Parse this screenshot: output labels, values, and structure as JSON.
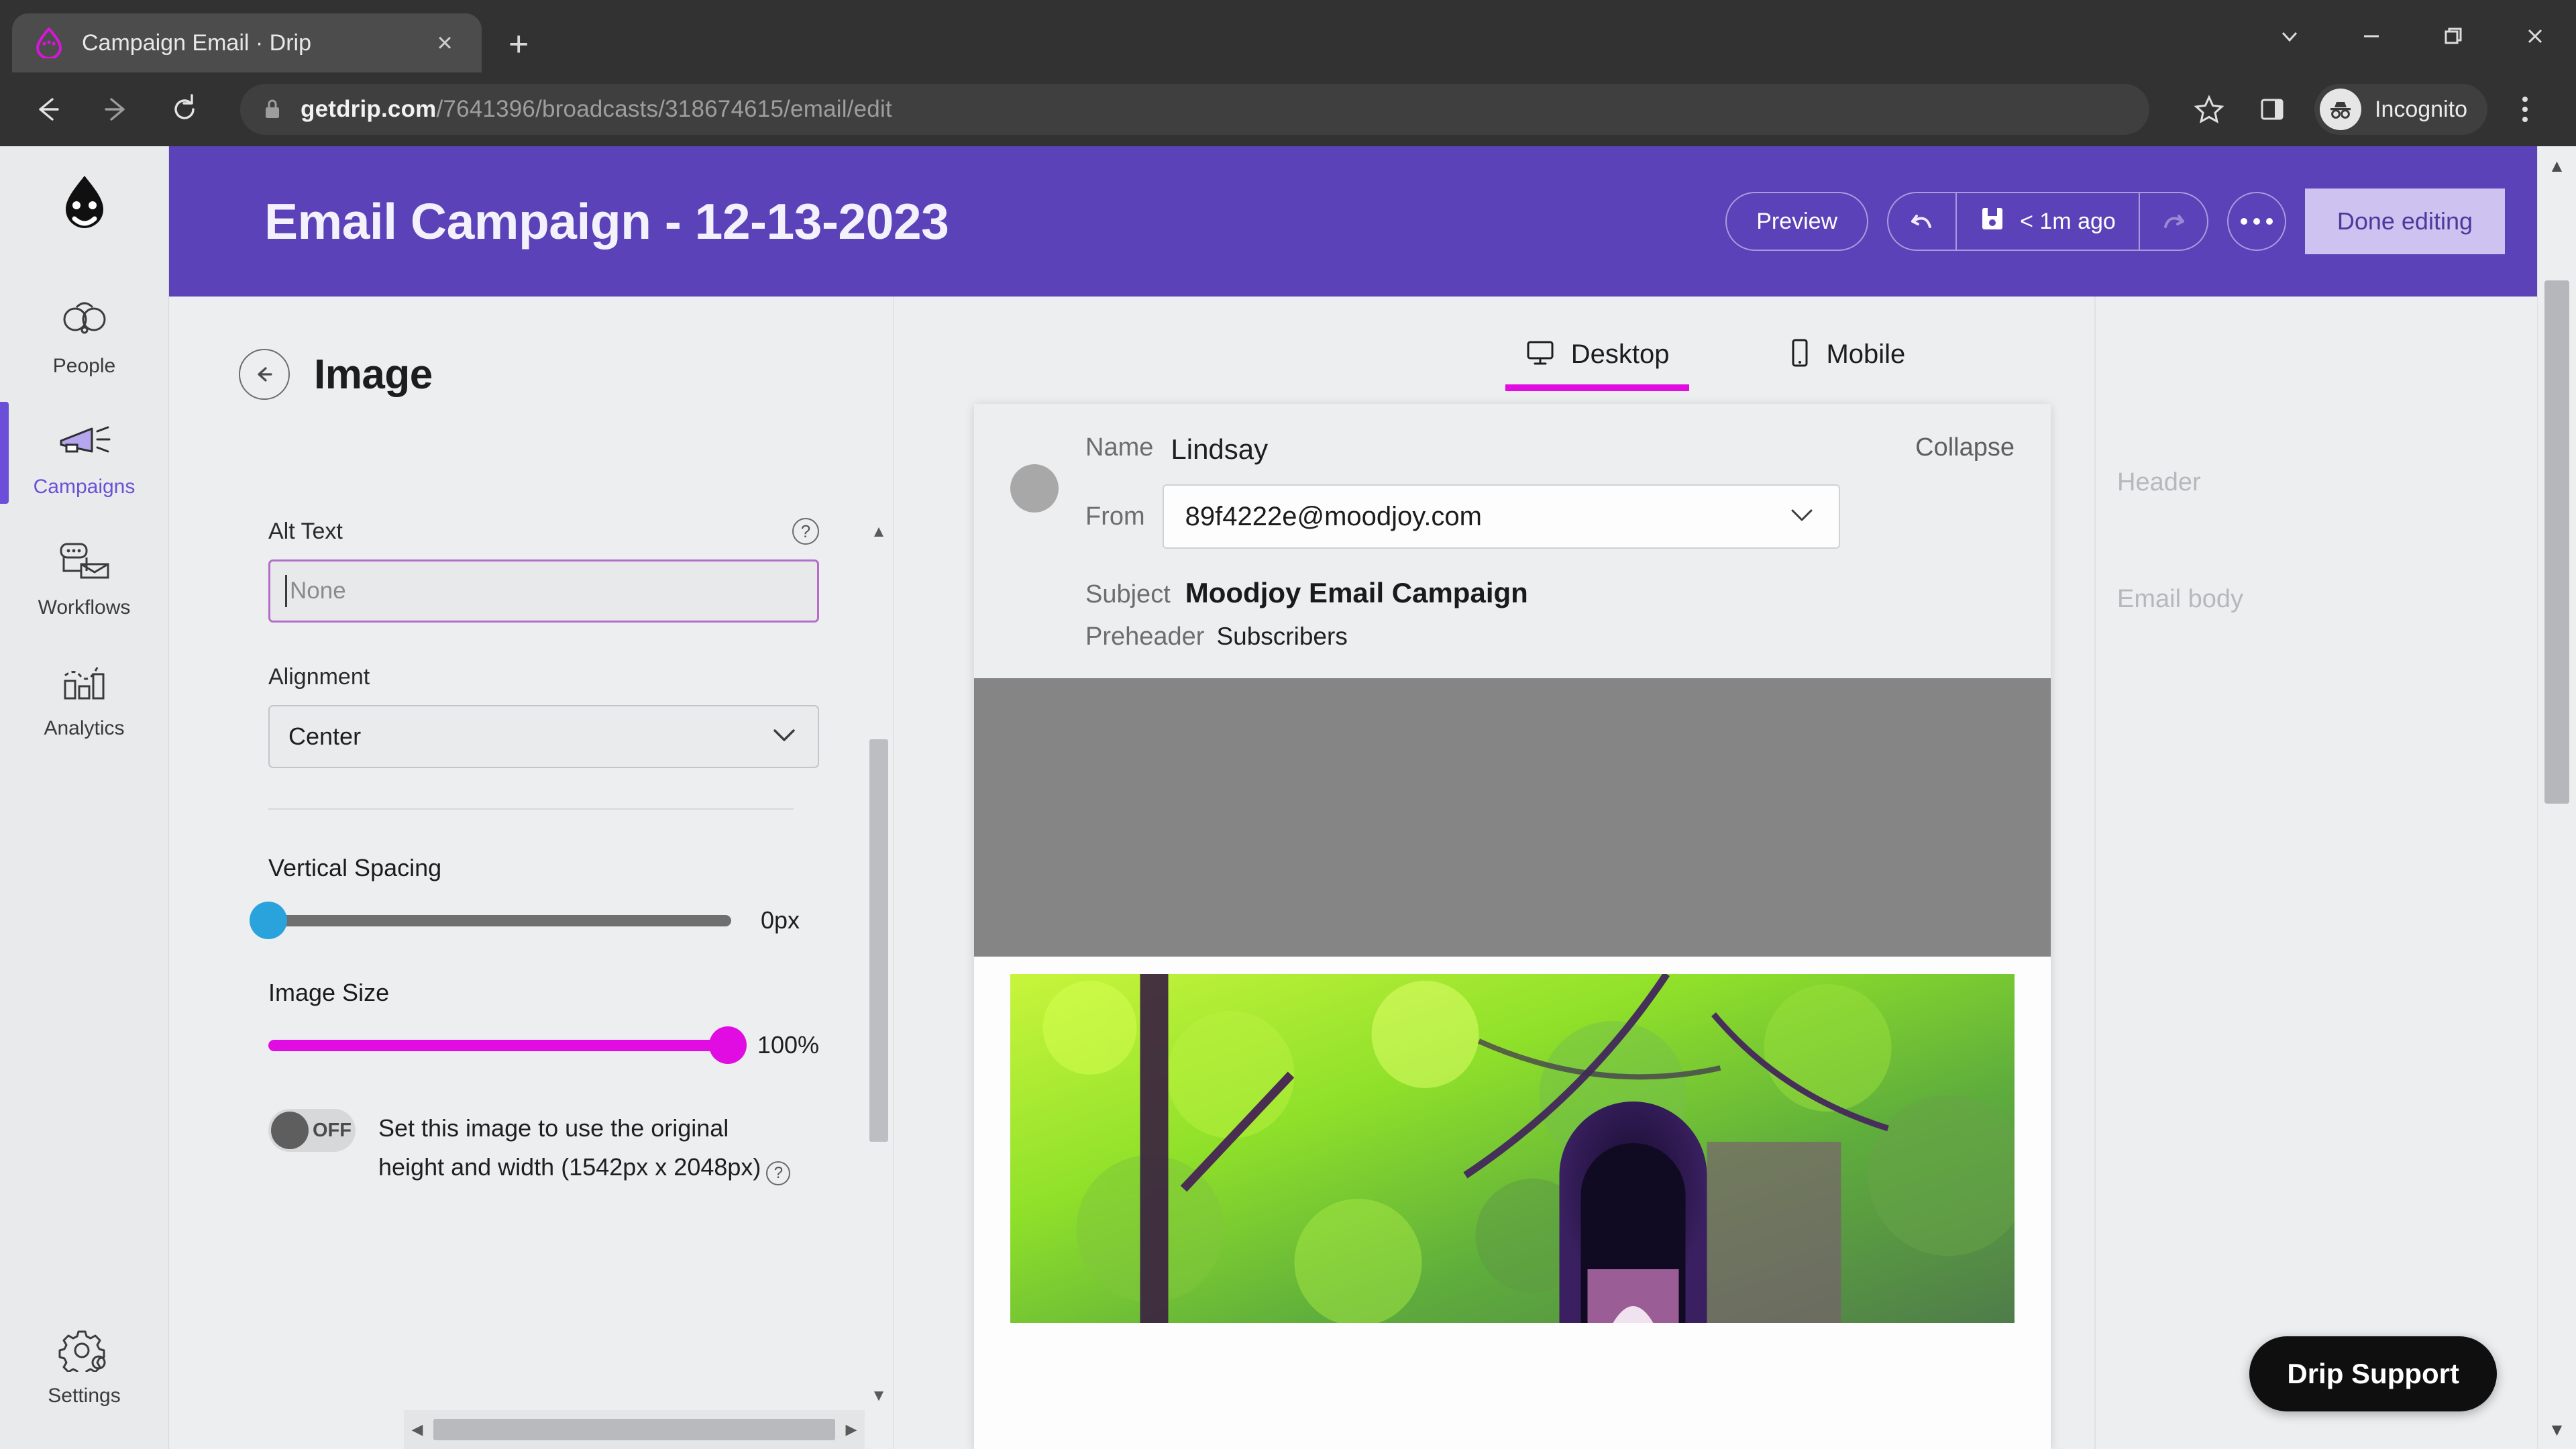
{
  "browser": {
    "tab": {
      "title": "Campaign Email · Drip",
      "favicon": "drip-logo-icon",
      "close": "×"
    },
    "new_tab_label": "+",
    "window_controls": [
      "chevron-down",
      "minimize",
      "restore",
      "close"
    ],
    "nav": {
      "back": "←",
      "forward": "→",
      "reload": "⟳"
    },
    "url_domain": "getdrip.com",
    "url_path": "/7641396/broadcasts/318674615/email/edit",
    "profile_label": "Incognito",
    "icons": {
      "lock": "lock-icon",
      "star": "star-icon",
      "side_panel": "side-panel-icon",
      "menu": "kebab-menu-icon"
    }
  },
  "sidebar": {
    "logo": "drip-face-logo",
    "items": [
      {
        "label": "People",
        "icon": "people-icon",
        "active": false
      },
      {
        "label": "Campaigns",
        "icon": "megaphone-icon",
        "active": true
      },
      {
        "label": "Workflows",
        "icon": "workflow-icon",
        "active": false
      },
      {
        "label": "Analytics",
        "icon": "bar-chart-icon",
        "active": false
      }
    ],
    "bottom_item": {
      "label": "Settings",
      "icon": "gears-icon"
    },
    "active_color": "#6c4fd8"
  },
  "header": {
    "title": "Email Campaign - 12-13-2023",
    "preview_label": "Preview",
    "undo_icon": "undo-arrow-icon",
    "save_icon": "floppy-disk-icon",
    "save_status": "< 1m ago",
    "redo_icon": "redo-arrow-icon",
    "more_label": "•••",
    "done_label": "Done editing",
    "bg_color": "#5b42b8",
    "done_bg": "#cdc2f0",
    "done_text_color": "#4b3a9c"
  },
  "panel": {
    "back_icon": "back-arrow-icon",
    "title": "Image",
    "alt_text": {
      "label": "Alt Text",
      "placeholder": "None",
      "value": "",
      "help": "?",
      "focused": true
    },
    "alignment": {
      "label": "Alignment",
      "value": "Center",
      "chevron": "chevron-down-icon"
    },
    "vertical_spacing": {
      "label": "Vertical Spacing",
      "value": "0px",
      "percent": 0,
      "knob_color": "#2aa3dd",
      "track_color": "#6f6f6f"
    },
    "image_size": {
      "label": "Image Size",
      "value": "100%",
      "percent": 100,
      "knob_color": "#e10ce1",
      "track_color": "#e10ce1"
    },
    "original_size_toggle": {
      "state": "OFF",
      "text_line1": "Set this image to use the original",
      "text_line2": "height and width (1542px x 2048px)",
      "help": "?"
    },
    "scroll_arrows": {
      "up": "▲",
      "down": "▼",
      "left": "◀",
      "right": "▶"
    }
  },
  "preview": {
    "tabs": [
      {
        "label": "Desktop",
        "icon": "monitor-icon",
        "active": true
      },
      {
        "label": "Mobile",
        "icon": "phone-icon",
        "active": false
      }
    ],
    "active_underline_color": "#e10ce1",
    "email": {
      "name_label": "Name",
      "name_value": "Lindsay",
      "collapse_label": "Collapse",
      "from_label": "From",
      "from_value": "89f4222e@moodjoy.com",
      "from_chevron": "chevron-down-icon",
      "subject_label": "Subject",
      "subject_value": "Moodjoy Email Campaign",
      "preheader_label": "Preheader",
      "preheader_value": "Subscribers"
    },
    "region_labels": [
      {
        "label": "Header"
      },
      {
        "label": "Email body"
      }
    ]
  },
  "support": {
    "label": "Drip Support"
  }
}
